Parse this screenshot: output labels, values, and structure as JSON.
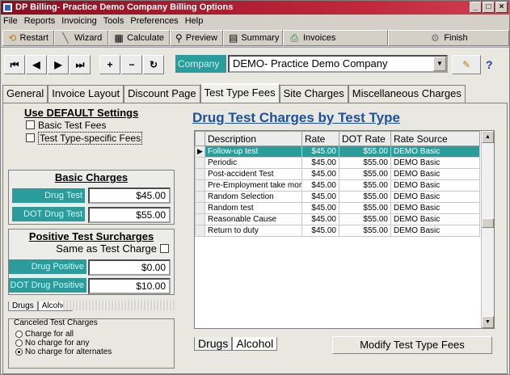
{
  "window": {
    "title": "DP Billing- Practice Demo Company Billing Options",
    "minimize": "_",
    "maximize": "□",
    "close": "×"
  },
  "menu": [
    "File",
    "Reports",
    "Invoicing",
    "Tools",
    "Preferences",
    "Help"
  ],
  "toolbar": {
    "restart": "Restart",
    "wizard": "Wizard",
    "calculate": "Calculate",
    "preview": "Preview",
    "summary": "Summary",
    "invoices": "Invoices",
    "finish": "Finish"
  },
  "nav": {
    "company_label": "Company",
    "company_value": "DEMO- Practice Demo Company",
    "help": "?"
  },
  "tabs": [
    "General",
    "Invoice Layout",
    "Discount Page",
    "Test Type Fees",
    "Site Charges",
    "Miscellaneous Charges"
  ],
  "active_tab": "Test Type Fees",
  "defaults": {
    "title": "Use DEFAULT Settings",
    "basic_test_fees": "Basic Test Fees",
    "test_type_specific": "Test Type-specific Fees"
  },
  "basic_charges": {
    "title": "Basic Charges",
    "drug_test_label": "Drug Test",
    "drug_test_value": "$45.00",
    "dot_drug_test_label": "DOT Drug Test",
    "dot_drug_test_value": "$55.00"
  },
  "surcharges": {
    "title": "Positive Test Surcharges",
    "same_as": "Same as Test Charge",
    "drug_positive_label": "Drug Positive",
    "drug_positive_value": "$0.00",
    "dot_drug_positive_label": "DOT Drug Positive",
    "dot_drug_positive_value": "$10.00"
  },
  "left_subtabs": [
    "Drugs",
    "Alcohol"
  ],
  "canceled": {
    "title": "Canceled Test Charges",
    "options": [
      "Charge for all",
      "No charge for any",
      "No charge for alternates"
    ],
    "selected_index": 2
  },
  "grid": {
    "title": "Drug Test Charges by Test Type",
    "columns": [
      "Description",
      "Rate",
      "DOT Rate",
      "Rate Source"
    ],
    "rows": [
      {
        "description": "Follow-up test",
        "rate": "$45.00",
        "dot_rate": "$55.00",
        "source": "DEMO Basic"
      },
      {
        "description": "Periodic",
        "rate": "$45.00",
        "dot_rate": "$55.00",
        "source": "DEMO Basic"
      },
      {
        "description": "Post-accident Test",
        "rate": "$45.00",
        "dot_rate": "$55.00",
        "source": "DEMO Basic"
      },
      {
        "description": "Pre-Employment take more",
        "rate": "$45.00",
        "dot_rate": "$55.00",
        "source": "DEMO Basic"
      },
      {
        "description": "Random Selection",
        "rate": "$45.00",
        "dot_rate": "$55.00",
        "source": "DEMO Basic"
      },
      {
        "description": "Random test",
        "rate": "$45.00",
        "dot_rate": "$55.00",
        "source": "DEMO Basic"
      },
      {
        "description": "Reasonable Cause",
        "rate": "$45.00",
        "dot_rate": "$55.00",
        "source": "DEMO Basic"
      },
      {
        "description": "Return to duty",
        "rate": "$45.00",
        "dot_rate": "$55.00",
        "source": "DEMO Basic"
      }
    ],
    "selected_row": 0
  },
  "bottom_subtabs": [
    "Drugs",
    "Alcohol"
  ],
  "modify_button": "Modify Test Type Fees",
  "colors": {
    "accent": "#2a9c9c",
    "title_bar": "#a01828"
  }
}
